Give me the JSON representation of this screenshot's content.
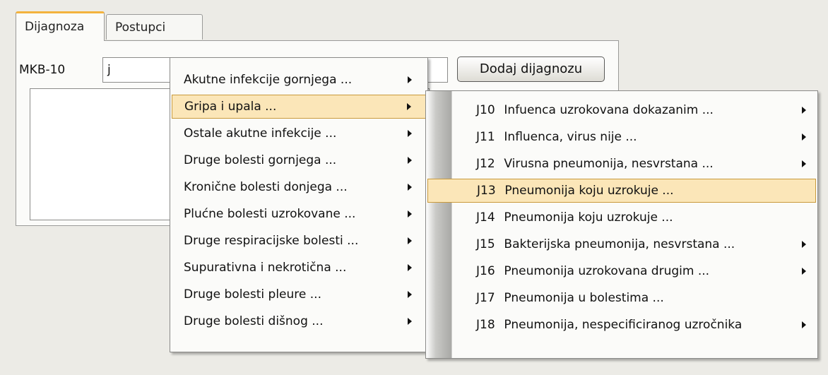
{
  "tabs": [
    {
      "label": "Dijagnoza",
      "active": true
    },
    {
      "label": "Postupci",
      "active": false
    }
  ],
  "form": {
    "mkb_label": "MKB-10",
    "mkb_value": "j",
    "add_button_label": "Dodaj dijagnozu"
  },
  "menu1": {
    "items": [
      {
        "label": "Akutne infekcije gornjega ...",
        "submenu": true
      },
      {
        "label": "Gripa i upala ...",
        "submenu": true,
        "highlighted": true
      },
      {
        "label": "Ostale akutne infekcije ...",
        "submenu": true
      },
      {
        "label": "Druge bolesti gornjega ...",
        "submenu": true
      },
      {
        "label": "Kronične bolesti donjega ...",
        "submenu": true
      },
      {
        "label": "Plućne bolesti uzrokovane ...",
        "submenu": true
      },
      {
        "label": "Druge respiracijske bolesti ...",
        "submenu": true
      },
      {
        "label": "Supurativna i nekrotična ...",
        "submenu": true
      },
      {
        "label": "Druge bolesti pleure ...",
        "submenu": true
      },
      {
        "label": "Druge bolesti dišnog ...",
        "submenu": true
      }
    ]
  },
  "menu2": {
    "items": [
      {
        "code": "J10",
        "label": "Infuenca uzrokovana dokazanim ...",
        "submenu": true
      },
      {
        "code": "J11",
        "label": "Influenca, virus nije ...",
        "submenu": true
      },
      {
        "code": "J12",
        "label": "Virusna pneumonija, nesvrstana ...",
        "submenu": true
      },
      {
        "code": "J13",
        "label": "Pneumonija koju uzrokuje ...",
        "submenu": false,
        "highlighted": true
      },
      {
        "code": "J14",
        "label": "Pneumonija koju uzrokuje ...",
        "submenu": false
      },
      {
        "code": "J15",
        "label": "Bakterijska pneumonija, nesvrstana ...",
        "submenu": true
      },
      {
        "code": "J16",
        "label": "Pneumonija uzrokovana drugim ...",
        "submenu": true
      },
      {
        "code": "J17",
        "label": "Pneumonija u bolestima ...",
        "submenu": false
      },
      {
        "code": "J18",
        "label": "Pneumonija, nespecificiranog uzročnika",
        "submenu": true
      }
    ]
  },
  "colors": {
    "highlight_bg": "#fbe6b8",
    "highlight_border": "#c99a3c",
    "active_tab_accent": "#f3b33e"
  }
}
